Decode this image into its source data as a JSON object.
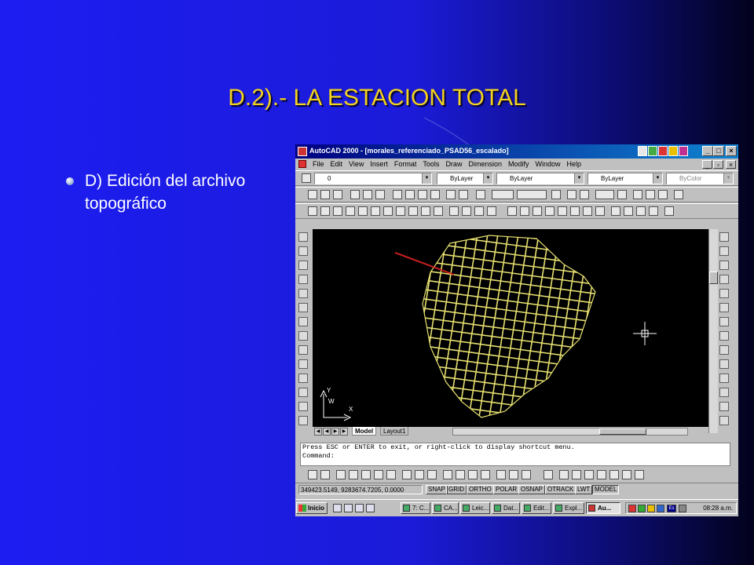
{
  "slide": {
    "title": "D.2).- LA ESTACION TOTAL",
    "bullet": "D) Edición del archivo topográfico"
  },
  "window": {
    "title": "AutoCAD 2000 - [morales_referenciado_PSAD56_escalado]",
    "controls": {
      "minimize": "_",
      "maximize": "□",
      "close": "×"
    }
  },
  "menu": [
    "File",
    "Edit",
    "View",
    "Insert",
    "Format",
    "Tools",
    "Draw",
    "Dimension",
    "Modify",
    "Window",
    "Help"
  ],
  "properties_toolbar": {
    "layer": "0",
    "color": "ByLayer",
    "linetype": "ByLayer",
    "lineweight": "ByLayer",
    "plotstyle": "ByColor"
  },
  "layout_tabs": [
    "Model",
    "Layout1"
  ],
  "command_lines": [
    "Press ESC or ENTER to exit, or right-click to display shortcut menu.",
    "Command:"
  ],
  "status": {
    "coordinates": "349423.5149, 9283674.7205, 0.0000",
    "modes": [
      "SNAP",
      "GRID",
      "ORTHO",
      "POLAR",
      "OSNAP",
      "OTRACK",
      "LWT",
      "MODEL"
    ]
  },
  "taskbar": {
    "start": "Inicio",
    "tasks": [
      "7: C...",
      "CA...",
      "Leic...",
      "Dat...",
      "Edit...",
      "Expl...",
      "Au..."
    ],
    "tray_lang": "Es",
    "clock": "08:28 a.m."
  },
  "ucs_icon": {
    "x_label": "X",
    "y_label": "Y",
    "w_label": "W"
  },
  "colors": {
    "drawing_bg": "#000000",
    "lines": "#e6e070",
    "title_text": "#f2d11f"
  }
}
